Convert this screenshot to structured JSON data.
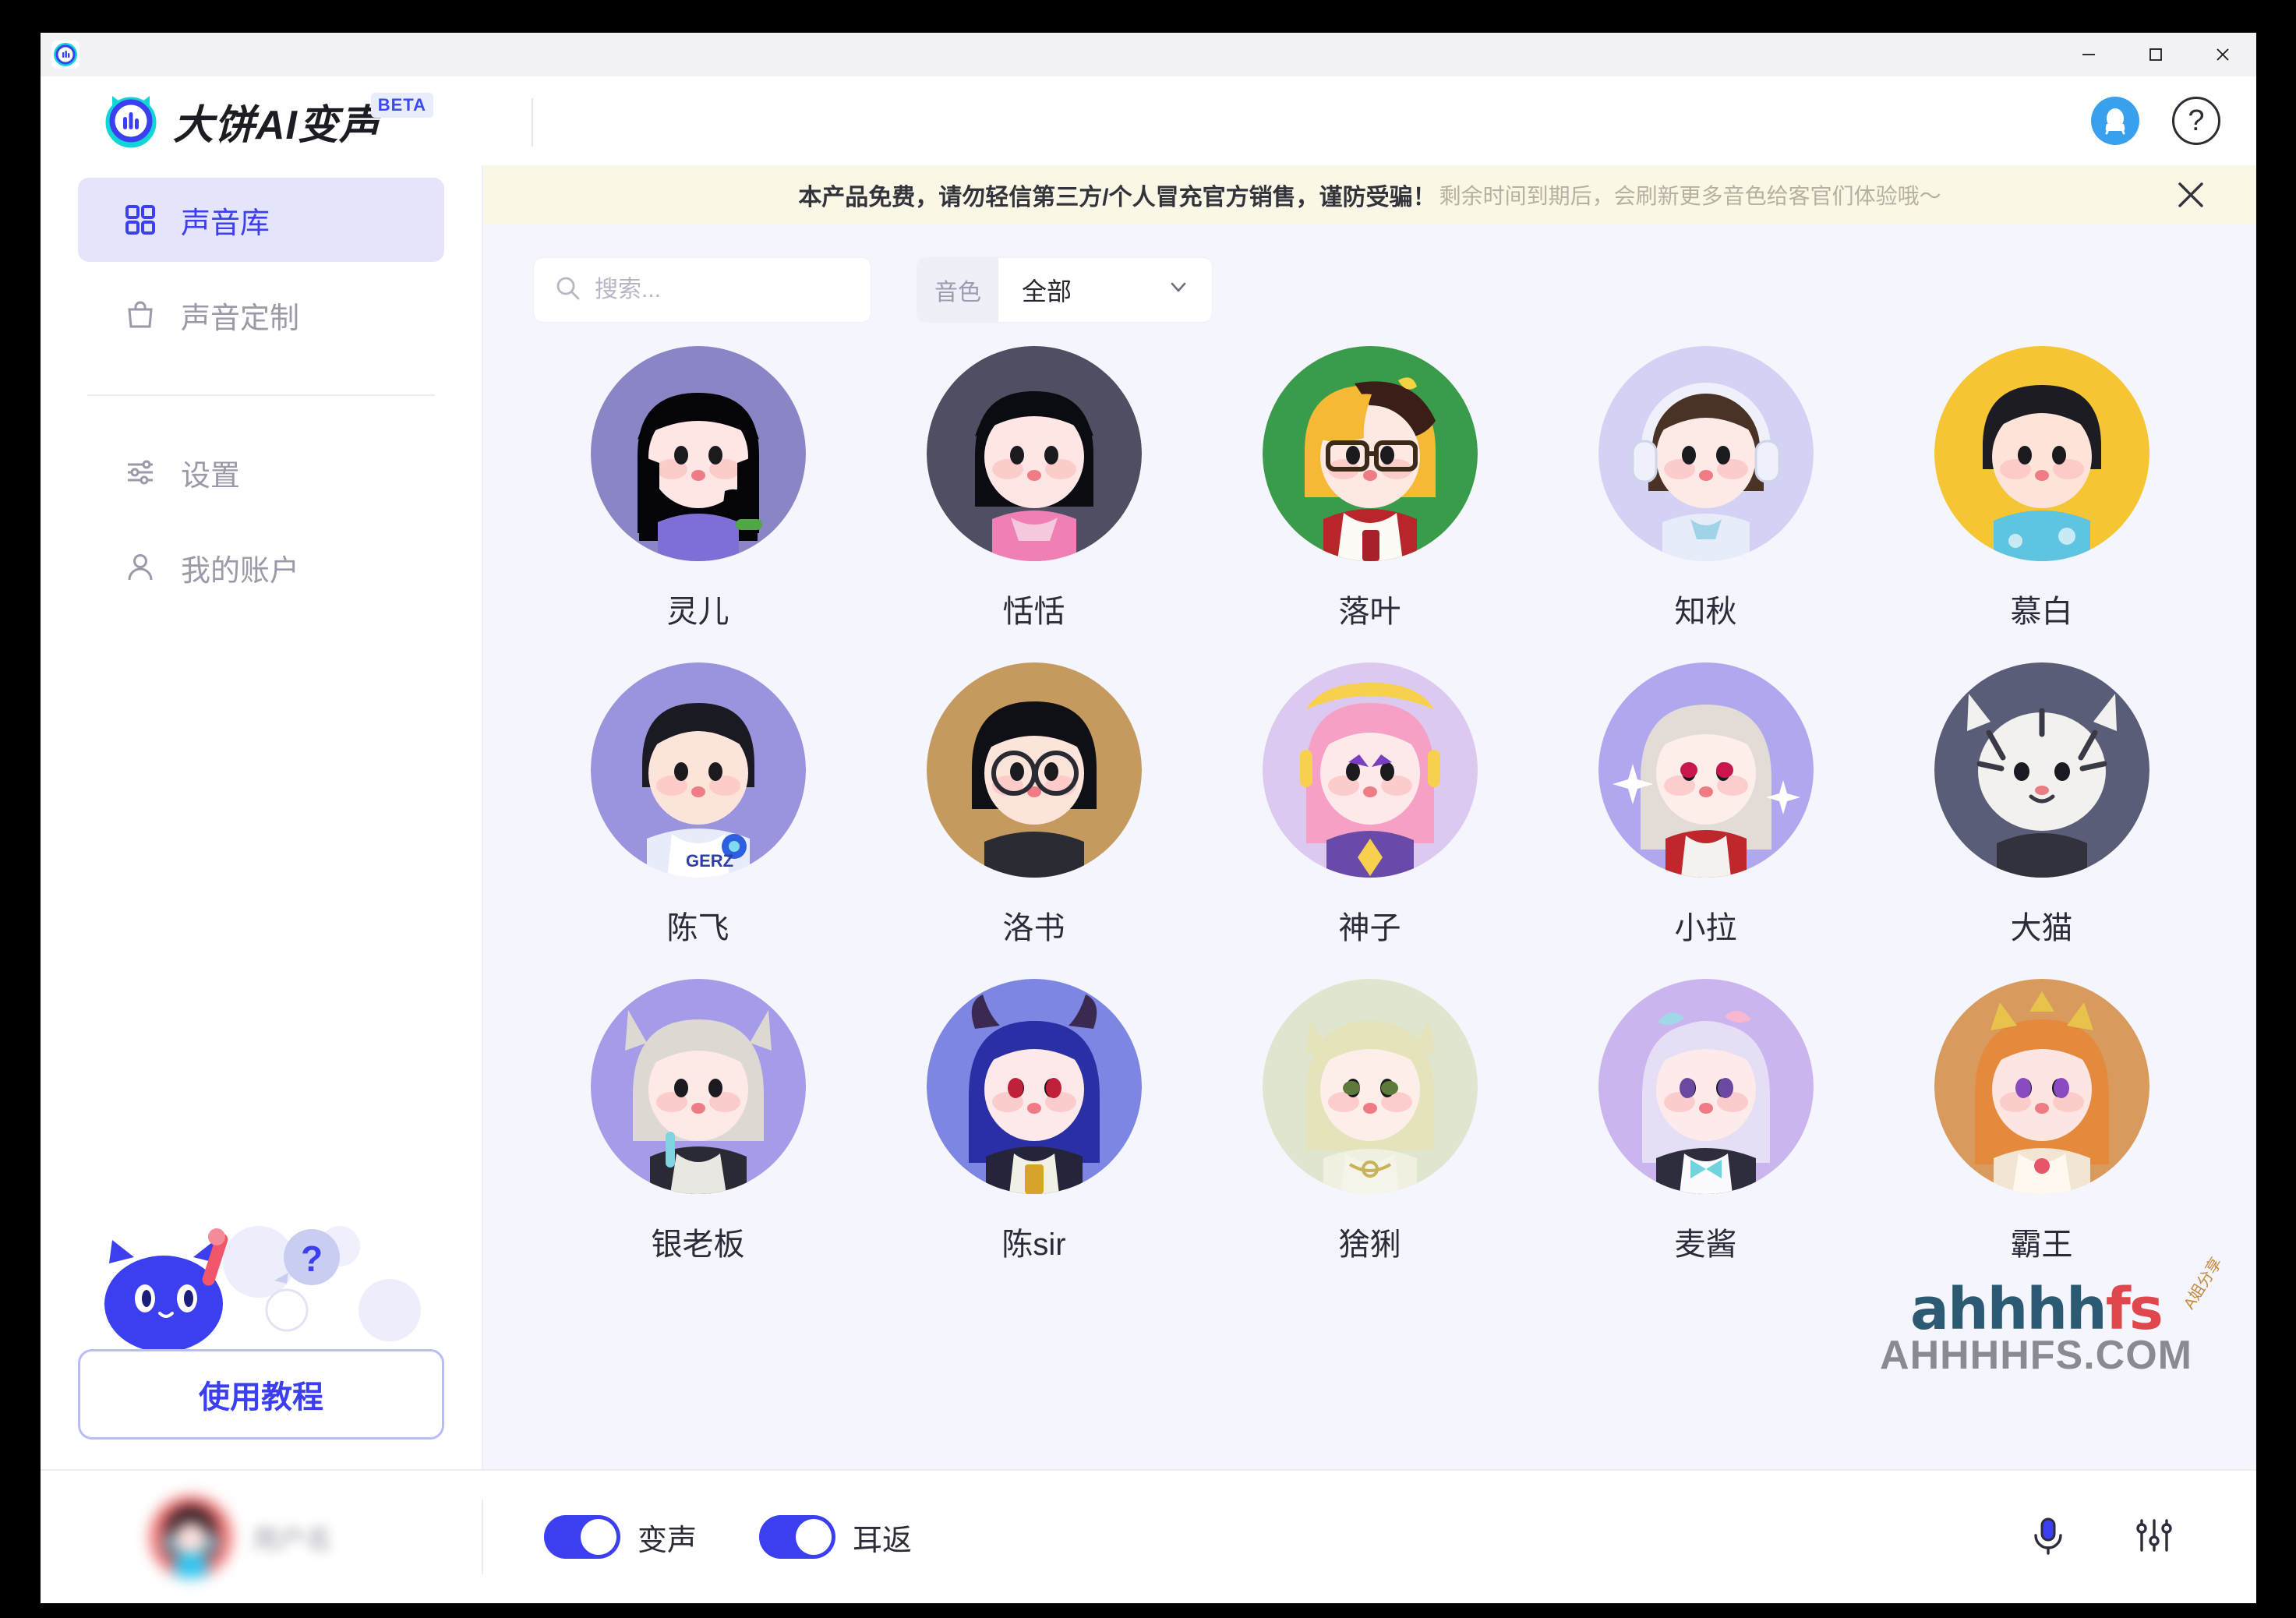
{
  "window": {
    "app_icon": "app-logo-icon",
    "controls": {
      "minimize": "—",
      "maximize": "□",
      "close": "✕"
    }
  },
  "header": {
    "brand_name": "大饼AI变声",
    "beta_badge": "BETA",
    "qq_icon": "qq-penguin-icon",
    "help_icon": "?"
  },
  "sidebar": {
    "items": [
      {
        "label": "声音库",
        "icon": "grid-icon",
        "active": true
      },
      {
        "label": "声音定制",
        "icon": "bag-icon",
        "active": false
      },
      {
        "label": "设置",
        "icon": "sliders-icon",
        "active": false
      },
      {
        "label": "我的账户",
        "icon": "person-icon",
        "active": false
      }
    ],
    "tutorial_button": "使用教程"
  },
  "notice": {
    "strong_text": "本产品免费，请勿轻信第三方/个人冒充官方销售，谨防受骗！",
    "light_text": "剩余时间到期后，会刷新更多音色给客官们体验哦～",
    "close_icon": "close-icon"
  },
  "toolbar": {
    "search_placeholder": "搜索...",
    "search_value": "",
    "search_icon": "search-icon",
    "filter_label": "音色",
    "filter_value": "全部",
    "filter_options": [
      "全部"
    ],
    "chevron_icon": "chevron-down-icon"
  },
  "voices": [
    {
      "name": "灵儿",
      "bg": "#8a85c4",
      "hair": "#050509",
      "skin": "#fde6e4",
      "cloth": "#7d6fd6",
      "style": "long-hair"
    },
    {
      "name": "恬恬",
      "bg": "#4f4f63",
      "hair": "#0b0b12",
      "skin": "#fde6e4",
      "cloth": "#f07fb5",
      "style": "bob"
    },
    {
      "name": "落叶",
      "bg": "#3a9b4a",
      "hair": "#f5b935",
      "skin": "#fde8e2",
      "cloth": "#b8252a",
      "style": "glasses-blond"
    },
    {
      "name": "知秋",
      "bg": "#d3d2f4",
      "hair": "#4a3226",
      "skin": "#fdeae6",
      "cloth": "#e7ecfa",
      "style": "headphones"
    },
    {
      "name": "慕白",
      "bg": "#f5c533",
      "hair": "#1c1c22",
      "skin": "#fde3d8",
      "cloth": "#5ec4e0",
      "style": "short-male"
    },
    {
      "name": "陈飞",
      "bg": "#9a93de",
      "hair": "#1a1a22",
      "skin": "#fde4db",
      "cloth": "#e8ecfa",
      "style": "jacket-male"
    },
    {
      "name": "洛书",
      "bg": "#c49a5e",
      "hair": "#0f0f16",
      "skin": "#fde4da",
      "cloth": "#2b2b33",
      "style": "glasses-dark"
    },
    {
      "name": "神子",
      "bg": "#dcc9ef",
      "hair": "#f5a0c4",
      "skin": "#fde9ea",
      "cloth": "#6a4aa8",
      "style": "pink-anime"
    },
    {
      "name": "小拉",
      "bg": "#b0a8ee",
      "hair": "#e3dcd6",
      "skin": "#fdeeea",
      "cloth": "#c0272d",
      "style": "white-hair"
    },
    {
      "name": "大猫",
      "bg": "#5a5d78",
      "hair": "#f3f1ee",
      "skin": "#f8f6f3",
      "cloth": "#32323c",
      "style": "tiger"
    },
    {
      "name": "银老板",
      "bg": "#a49ce8",
      "hair": "#ded8d2",
      "skin": "#fdeae6",
      "cloth": "#2a2a34",
      "style": "silver-boy"
    },
    {
      "name": "陈sir",
      "bg": "#7d87e3",
      "hair": "#2b2fa6",
      "skin": "#fde8ea",
      "cloth": "#24243a",
      "style": "horned"
    },
    {
      "name": "猞猁",
      "bg": "#dfe6cf",
      "hair": "#e4e3bb",
      "skin": "#fdeeea",
      "cloth": "#f0efe0",
      "style": "lynx"
    },
    {
      "name": "麦酱",
      "bg": "#cbb5ee",
      "hair": "#e6def5",
      "skin": "#fdeaea",
      "cloth": "#2d2d3e",
      "style": "bow-girl"
    },
    {
      "name": "霸王",
      "bg": "#d99a5e",
      "hair": "#e58a3c",
      "skin": "#fde6e2",
      "cloth": "#f3e5d4",
      "style": "orange-anime"
    }
  ],
  "footer": {
    "user_name": "用户名",
    "toggles": [
      {
        "label": "变声",
        "on": true
      },
      {
        "label": "耳返",
        "on": true
      }
    ],
    "mic_icon": "microphone-icon",
    "eq_icon": "equalizer-icon"
  },
  "watermark": {
    "script_dark": "ahhhh",
    "script_red": "fs",
    "domain": "AHHHHFS.COM",
    "rotated": "A姐分享"
  }
}
